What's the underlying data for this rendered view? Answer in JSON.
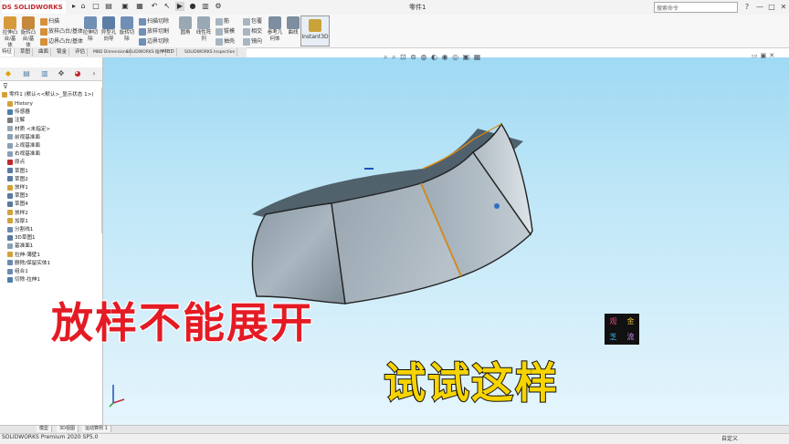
{
  "app": {
    "logo_brand": "DS SOLIDWORKS",
    "document_title": "零件1",
    "search_placeholder": "搜索命令",
    "window_controls": [
      "?",
      "—",
      "□",
      "✕"
    ]
  },
  "ribbon": {
    "groups": [
      {
        "label": "拉伸凸台/基体"
      },
      {
        "label": "旋转凸台/基体"
      },
      {
        "label": "扫描"
      },
      {
        "label": "放样凸台/基体"
      },
      {
        "label": "边界凸台/基体"
      },
      {
        "label": "拉伸切除"
      },
      {
        "label": "异型孔向导"
      },
      {
        "label": "旋转切除"
      },
      {
        "label": "扫描切除"
      },
      {
        "label": "放样切割"
      },
      {
        "label": "边界切除"
      },
      {
        "label": "圆角"
      },
      {
        "label": "线性阵列"
      },
      {
        "label": "筋"
      },
      {
        "label": "拔模"
      },
      {
        "label": "抽壳"
      },
      {
        "label": "包覆"
      },
      {
        "label": "相交"
      },
      {
        "label": "镜向"
      },
      {
        "label": "参考几何体"
      },
      {
        "label": "曲线"
      },
      {
        "label": "Instant3D"
      }
    ],
    "eval_label": "Instant3D"
  },
  "tabs": [
    "特征",
    "草图",
    "曲面",
    "钣金",
    "评估",
    "MBD Dimensions",
    "SOLIDWORKS 插件",
    "MBD",
    "SOLIDWORKS Inspection"
  ],
  "feature_tree": {
    "root": "零件1 (默认<<默认>_显示状态 1>)",
    "items": [
      "History",
      "传感器",
      "注解",
      "材质 <未指定>",
      "前视基准面",
      "上视基准面",
      "右视基准面",
      "原点",
      "草图1",
      "草图2",
      "放样1",
      "草图3",
      "草图4",
      "放样2",
      "加厚1",
      "分割线1",
      "3D草图1",
      "基准面1",
      "拉伸-薄壁1",
      "删除/保留实体1",
      "组合1",
      "切除-拉伸1"
    ]
  },
  "captions": {
    "line1": "放样不能展开",
    "line2": "试试这样"
  },
  "watermark": [
    "观",
    "金",
    "芝",
    "流"
  ],
  "bottom_tabs": [
    "模型",
    "3D视图",
    "运动算例 1"
  ],
  "status": {
    "text": "SOLIDWORKS Premium 2020 SP5.0",
    "unit": "自定义"
  },
  "colors": {
    "viewport_top": "#9fd9f3",
    "viewport_bottom": "#e6f5fc",
    "caption1": "#e41b24",
    "caption2": "#f7d400",
    "edge_highlight": "#e08a10"
  }
}
